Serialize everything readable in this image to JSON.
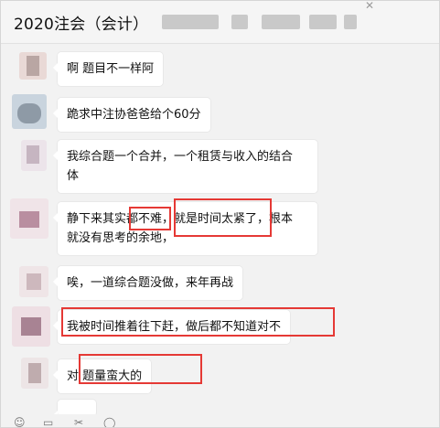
{
  "window": {
    "title": "2020注会（会计）",
    "controls": {
      "close_glyph": "✕"
    }
  },
  "messages": [
    {
      "text": "啊 题目不一样阿"
    },
    {
      "text": "跪求中注协爸爸给个60分"
    },
    {
      "line1": "我综合题一个合并，一个租赁与收入的结合",
      "line2": "体"
    },
    {
      "line1": "静下来其实都不难，就是时间太紧了，根本",
      "line2": "就没有思考的余地，"
    },
    {
      "text": "唉，一道综合题没做，来年再战"
    },
    {
      "text": "我被时间推着往下赶，做后都不知道对不"
    },
    {
      "text": "对 题量蛮大的"
    }
  ],
  "toolbar": {
    "icons": [
      "emoji-icon",
      "folder-icon",
      "scissors-icon",
      "chat-history-icon"
    ]
  },
  "colors": {
    "highlight_box": "#e53935",
    "bubble": "#ffffff",
    "background": "#f2f2f2"
  }
}
